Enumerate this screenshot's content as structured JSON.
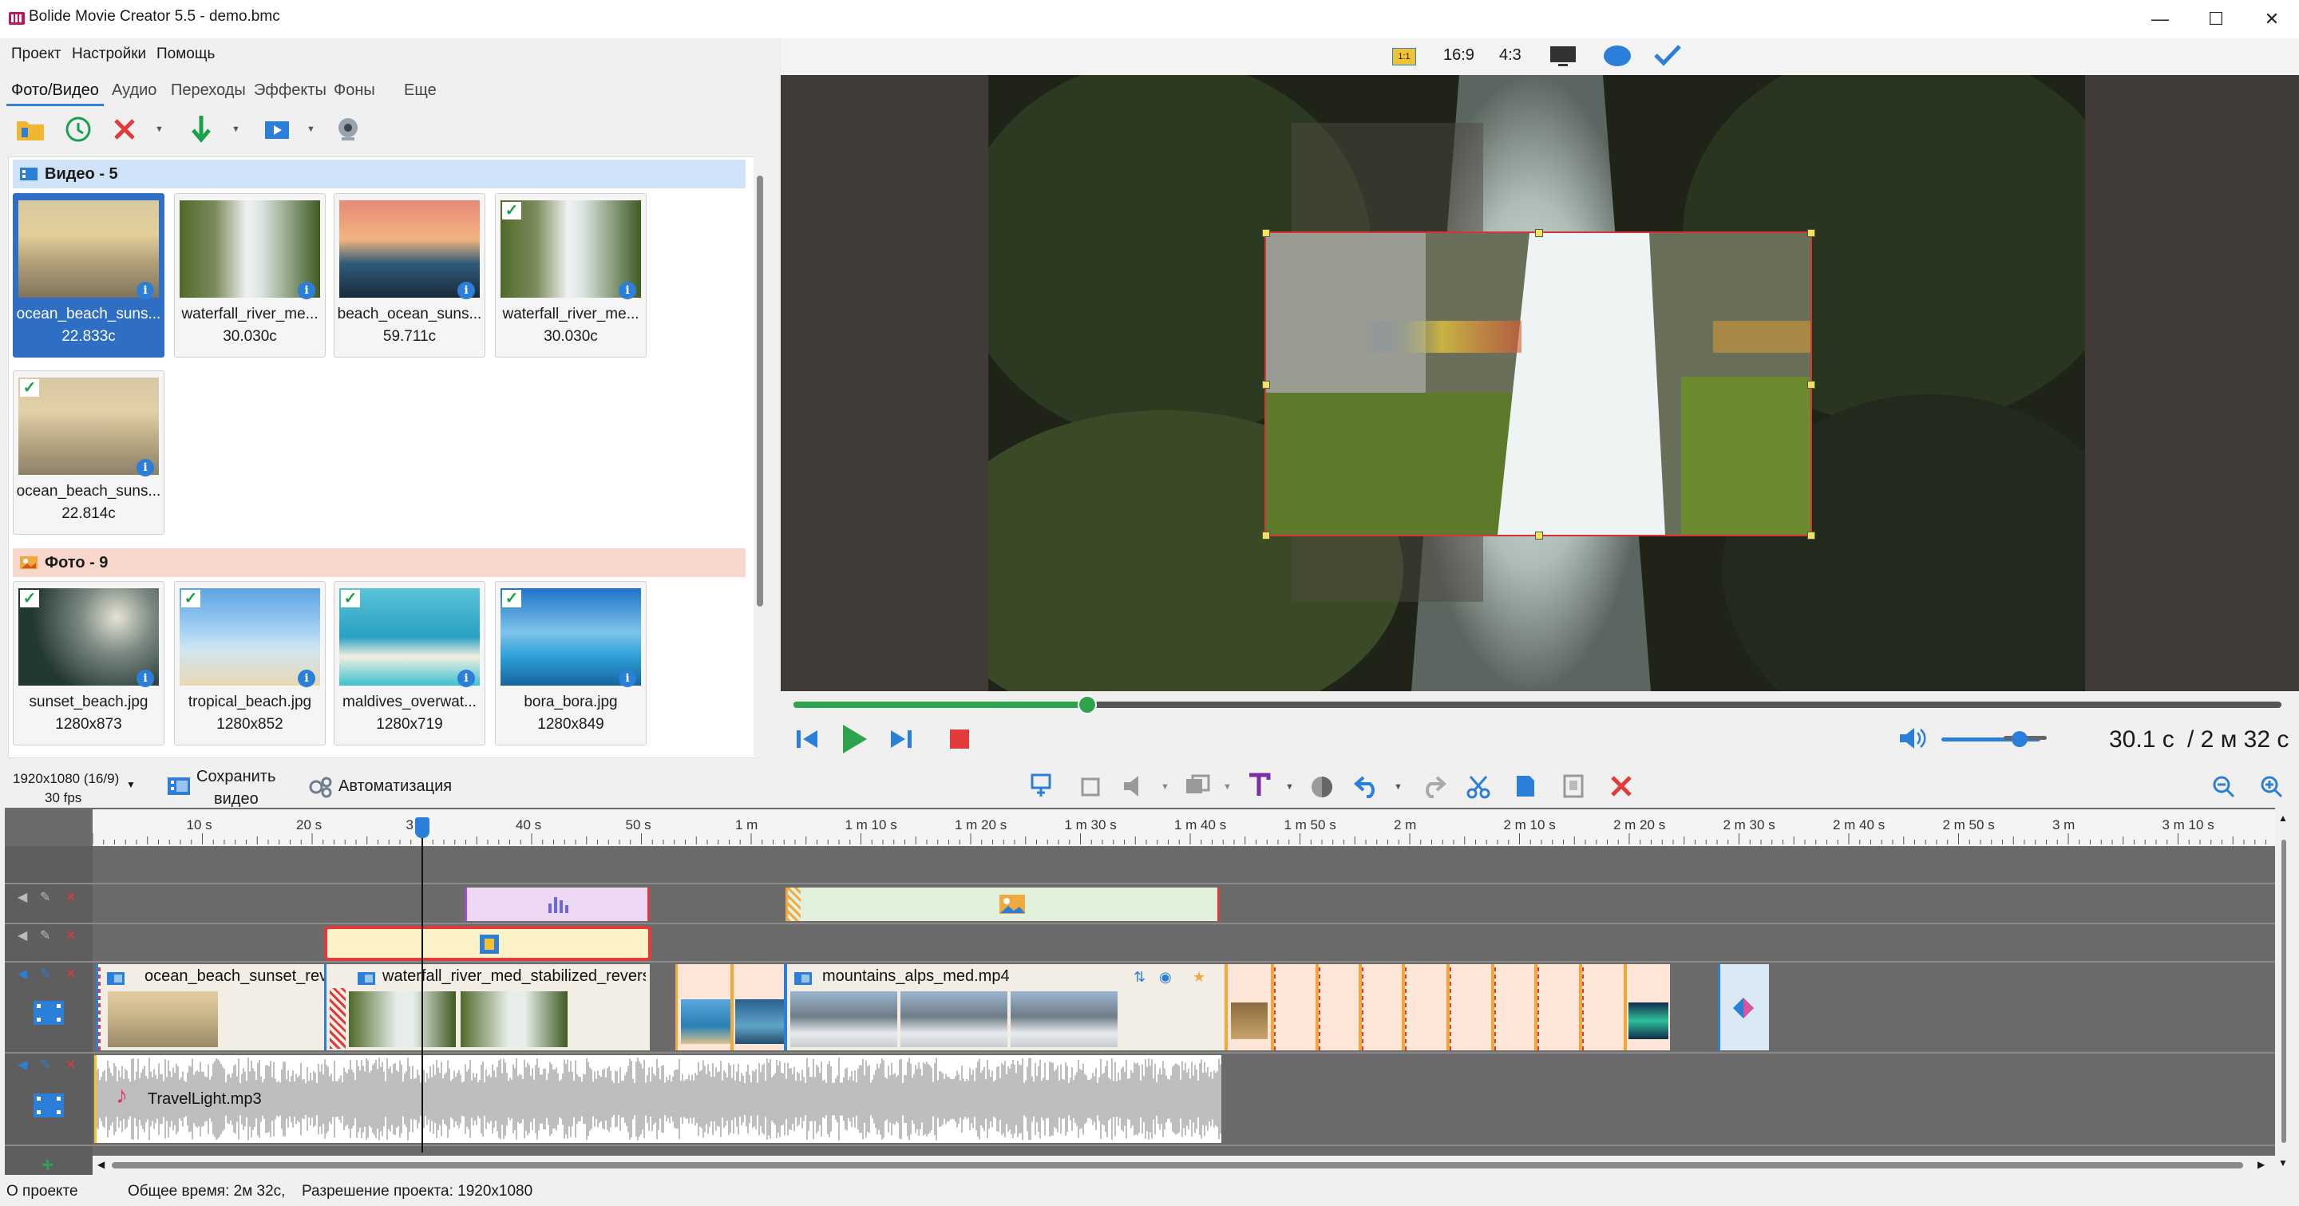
{
  "window": {
    "title": "Bolide Movie Creator 5.5 - demo.bmc",
    "controls": [
      "—",
      "☐",
      "✕"
    ]
  },
  "menu": [
    "Проект",
    "Настройки",
    "Помощь"
  ],
  "tabs": [
    "Фото/Видео",
    "Аудио",
    "Переходы",
    "Эффекты",
    "Фоны",
    "Еще"
  ],
  "media": {
    "video_group": "Видео - 5",
    "photo_group": "Фото - 9",
    "videos": [
      {
        "name": "ocean_beach_suns...",
        "meta": "22.833с",
        "selected": true,
        "checked": false
      },
      {
        "name": "waterfall_river_me...",
        "meta": "30.030с",
        "selected": false,
        "checked": false
      },
      {
        "name": "beach_ocean_suns...",
        "meta": "59.711с",
        "selected": false,
        "checked": false
      },
      {
        "name": "waterfall_river_me...",
        "meta": "30.030с",
        "selected": false,
        "checked": true
      },
      {
        "name": "ocean_beach_suns...",
        "meta": "22.814с",
        "selected": false,
        "checked": true
      }
    ],
    "photos": [
      {
        "name": "sunset_beach.jpg",
        "meta": "1280x873",
        "checked": true
      },
      {
        "name": "tropical_beach.jpg",
        "meta": "1280x852",
        "checked": true
      },
      {
        "name": "maldives_overwat...",
        "meta": "1280x719",
        "checked": true
      },
      {
        "name": "bora_bora.jpg",
        "meta": "1280x849",
        "checked": true
      }
    ],
    "info_glyph": "i",
    "check_glyph": "✓"
  },
  "preview": {
    "aspect_options": [
      "1:1",
      "16:9",
      "4:3"
    ],
    "progress": 0.2,
    "volume": 0.8,
    "time_current": "30.1 с",
    "time_total": "/ 2 м 32 с"
  },
  "project": {
    "resolution_line1": "1920x1080 (16/9)",
    "resolution_line2": "30 fps",
    "save_video_line1": "Сохранить",
    "save_video_line2": "видео",
    "automation": "Автоматизация"
  },
  "timeline": {
    "ruler": [
      "10 s",
      "20 s",
      "3",
      "40 s",
      "50 s",
      "1 m",
      "1 m 10 s",
      "1 m 20 s",
      "1 m 30 s",
      "1 m 40 s",
      "1 m 50 s",
      "2 m",
      "2 m 10 s",
      "2 m 20 s",
      "2 m 30 s",
      "2 m 40 s",
      "2 m 50 s",
      "3 m",
      "3 m 10 s"
    ],
    "clips": {
      "clip1": "ocean_beach_sunset_rev...",
      "clip2": "waterfall_river_med_stabilized_reverse...",
      "clip3": "mountains_alps_med.mp4",
      "audio": "TravelLight.mp3"
    },
    "add_track": "+"
  },
  "status": {
    "about": "О проекте",
    "total_time": "Общее время: 2м 32с,",
    "resolution": "Разрешение проекта:   1920x1080"
  },
  "colors": {
    "accent": "#2c7fd8",
    "play_green": "#2ea24c",
    "stop_red": "#e03a3a",
    "video_group_bg": "#cfe2f7",
    "photo_group_bg": "#f7d6cc"
  }
}
